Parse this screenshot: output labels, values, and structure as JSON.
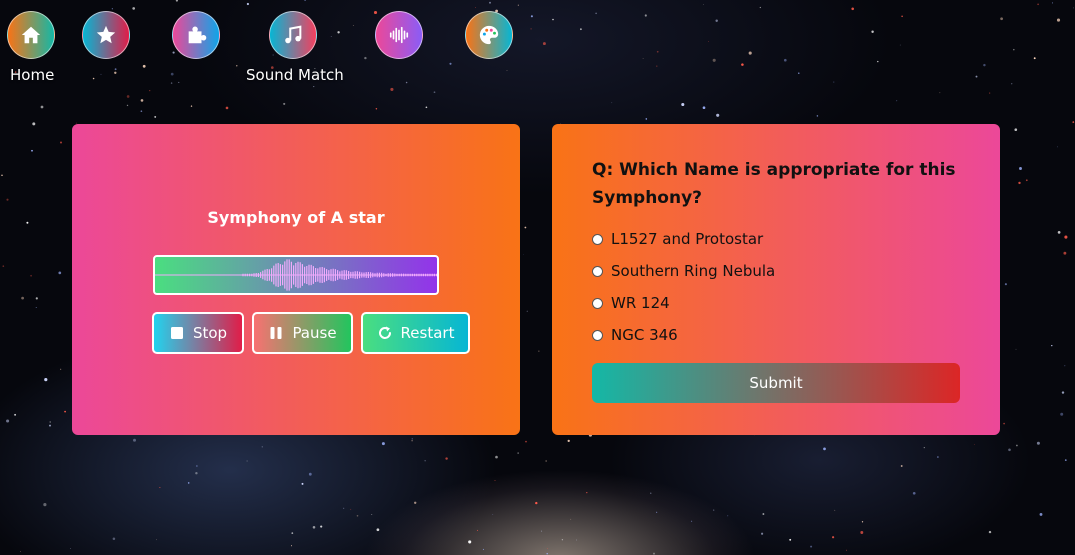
{
  "nav": {
    "items": [
      {
        "icon": "home-icon",
        "label": "Home"
      },
      {
        "icon": "star-icon",
        "label": ""
      },
      {
        "icon": "puzzle-icon",
        "label": ""
      },
      {
        "icon": "music-note-icon",
        "label": "Sound Match"
      },
      {
        "icon": "audio-waveform-icon",
        "label": ""
      },
      {
        "icon": "palette-icon",
        "label": ""
      }
    ]
  },
  "player": {
    "title": "Symphony of A star",
    "stop_label": "Stop",
    "pause_label": "Pause",
    "restart_label": "Restart"
  },
  "quiz": {
    "question": "Q: Which Name is appropriate for this Symphony?",
    "options": [
      "L1527 and Protostar",
      "Southern Ring Nebula",
      "WR 124",
      "NGC 346"
    ],
    "submit_label": "Submit"
  }
}
